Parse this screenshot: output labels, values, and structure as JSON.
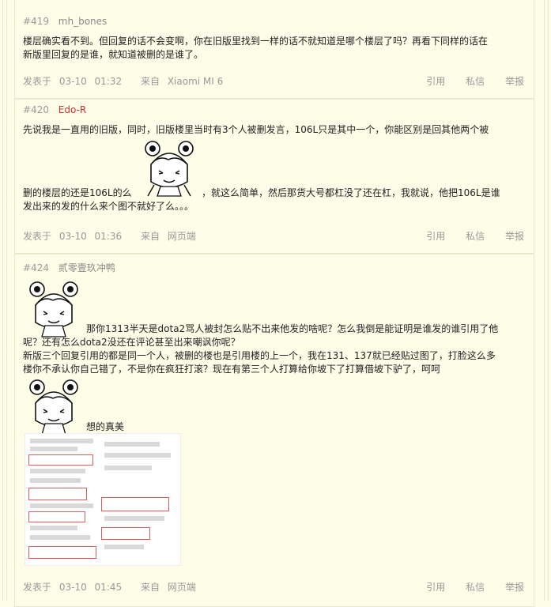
{
  "posts": [
    {
      "floor": "#419",
      "author": "mh_bones",
      "text_lines": [
        "楼层确实看不到。但回复的话不会变啊，你在旧版里找到一样的话不就知道是哪个楼层了吗？再看下同样的话在",
        "新版里回复的是谁，就知道被删的是谁了。"
      ],
      "posted_label": "发表于",
      "date": "03-10",
      "time": "01:32",
      "from_label": "来自",
      "source": "Xiaomi  MI  6"
    },
    {
      "floor": "#420",
      "author": "Edo-R",
      "text_lines": [
        "先说我是一直用的旧版，同时，旧版楼里当时有3个人被删发言，106L只是其中一个，你能区别是回其他两个被",
        "删的楼层的还是106L的么",
        "，就这么简单，然后那货大号都杠没了还在杠，我就说，他把106L是谁",
        "发出来的发的什么来个图不就好了么。。。"
      ],
      "posted_label": "发表于",
      "date": "03-10",
      "time": "01:36",
      "from_label": "来自",
      "source": "网页端"
    },
    {
      "floor": "#424",
      "author": "贰零壹玖冲鸭",
      "text_lines": [
        "那你1313半天是dota2骂人被封怎么贴不出来他发的啥呢？怎么我倒是能证明是谁发的谁引用了他",
        "呢？还有怎么dota2没还在评论甚至出来嘲讽你呢？",
        "新版三个回复引用的都是同一个人，被删的楼也是引用楼的上一个，我在131、137就已经贴过图了，打脸这么多",
        "楼你不承认你自己错了，不是你在疯狂打滚？现在有第三个人打算给你坡下了打算借坡下驴了，呵呵",
        "想的真美"
      ],
      "posted_label": "发表于",
      "date": "03-10",
      "time": "01:45",
      "from_label": "来自",
      "source": "网页端"
    }
  ],
  "actions": {
    "quote": "引用",
    "message": "私信",
    "report": "举报"
  },
  "colors": {
    "background": "#fdfde8",
    "border": "#ebe9cc",
    "author_highlight": "#cc3333",
    "meta_text": "#999999"
  }
}
